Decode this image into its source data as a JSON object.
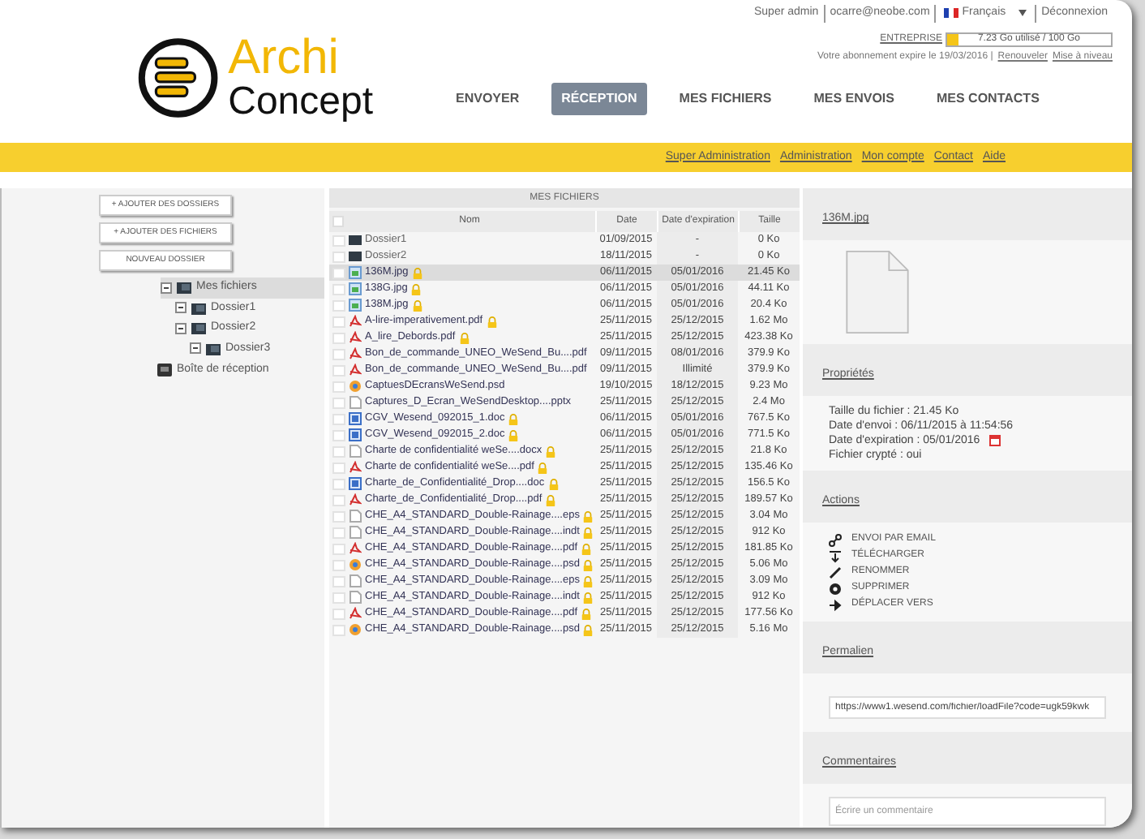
{
  "top_bar": {
    "user": "Super admin",
    "email": "ocarre@neobe.com",
    "language": "Français",
    "logout": "Déconnexion"
  },
  "logo": {
    "word_1": "Archi",
    "word_2": "Concept"
  },
  "quota": {
    "plan": "ENTREPRISE",
    "usage": "7.23 Go utilisé / 100 Go",
    "level": 0.07
  },
  "subscription": {
    "text": "Votre abonnement expire le 19/03/2016 |",
    "renew": "Renouveler",
    "upgrade": "Mise à niveau"
  },
  "nav_tabs": [
    {
      "label": "ENVOYER",
      "selected": false
    },
    {
      "label": "RÉCEPTION",
      "selected": true
    },
    {
      "label": "MES FICHIERS",
      "selected": false
    },
    {
      "label": "MES ENVOIS",
      "selected": false
    },
    {
      "label": "MES CONTACTS",
      "selected": false
    }
  ],
  "admin_links": [
    "Super Administration",
    "Administration",
    "Mon compte",
    "Contact",
    "Aide"
  ],
  "sidebar": {
    "buttons": [
      "+ AJOUTER DES DOSSIERS",
      "+ AJOUTER DES FICHIERS",
      "NOUVEAU DOSSIER"
    ],
    "tree": [
      {
        "label": "Mes fichiers",
        "selected": true,
        "expanded": true,
        "children": [
          {
            "label": "Dossier1",
            "selected": false,
            "expanded": true
          },
          {
            "label": "Dossier2",
            "selected": false,
            "expanded": true,
            "children": [
              {
                "label": "Dossier3",
                "selected": false,
                "expanded": true
              }
            ]
          }
        ]
      }
    ],
    "inbox": "Boîte de réception"
  },
  "table": {
    "title": "MES FICHIERS",
    "select_all_checked": false,
    "columns": [
      "Nom",
      "Date",
      "Date d'expiration",
      "Taille"
    ],
    "rows": [
      {
        "kind": "folder",
        "name": "Dossier1",
        "date": "01/09/2015",
        "expiry": "-",
        "size": "0 Ko",
        "locked": false,
        "selected": false,
        "checked": false
      },
      {
        "kind": "folder",
        "name": "Dossier2",
        "date": "18/11/2015",
        "expiry": "-",
        "size": "0 Ko",
        "locked": false,
        "selected": false,
        "checked": false
      },
      {
        "kind": "image",
        "name": "136M.jpg",
        "date": "06/11/2015",
        "expiry": "05/01/2016",
        "size": "21.45 Ko",
        "locked": true,
        "selected": true,
        "checked": false
      },
      {
        "kind": "image",
        "name": "138G.jpg",
        "date": "06/11/2015",
        "expiry": "05/01/2016",
        "size": "44.11 Ko",
        "locked": true,
        "selected": false,
        "checked": false
      },
      {
        "kind": "image",
        "name": "138M.jpg",
        "date": "06/11/2015",
        "expiry": "05/01/2016",
        "size": "20.4 Ko",
        "locked": true,
        "selected": false,
        "checked": false
      },
      {
        "kind": "pdf",
        "name": "A-lire-imperativement.pdf",
        "date": "25/11/2015",
        "expiry": "25/12/2015",
        "size": "1.62 Mo",
        "locked": true,
        "selected": false,
        "checked": false
      },
      {
        "kind": "pdf",
        "name": "A_lire_Debords.pdf",
        "date": "25/11/2015",
        "expiry": "25/12/2015",
        "size": "423.38 Ko",
        "locked": true,
        "selected": false,
        "checked": false
      },
      {
        "kind": "pdf",
        "name": "Bon_de_commande_UNEO_WeSend_Bu....pdf",
        "date": "09/11/2015",
        "expiry": "08/01/2016",
        "size": "379.9 Ko",
        "locked": false,
        "selected": false,
        "checked": false
      },
      {
        "kind": "pdf",
        "name": "Bon_de_commande_UNEO_WeSend_Bu....pdf",
        "date": "09/11/2015",
        "expiry": "Illimité",
        "size": "379.9 Ko",
        "locked": false,
        "selected": false,
        "checked": false
      },
      {
        "kind": "psd",
        "name": "CaptuesDEcransWeSend.psd",
        "date": "19/10/2015",
        "expiry": "18/12/2015",
        "size": "9.23 Mo",
        "locked": false,
        "selected": false,
        "checked": false
      },
      {
        "kind": "blank",
        "name": "Captures_D_Ecran_WeSendDesktop....pptx",
        "date": "25/11/2015",
        "expiry": "25/12/2015",
        "size": "2.4 Mo",
        "locked": false,
        "selected": false,
        "checked": false
      },
      {
        "kind": "doc",
        "name": "CGV_Wesend_092015_1.doc",
        "date": "06/11/2015",
        "expiry": "05/01/2016",
        "size": "767.5 Ko",
        "locked": true,
        "selected": false,
        "checked": false
      },
      {
        "kind": "doc",
        "name": "CGV_Wesend_092015_2.doc",
        "date": "06/11/2015",
        "expiry": "05/01/2016",
        "size": "771.5 Ko",
        "locked": true,
        "selected": false,
        "checked": false
      },
      {
        "kind": "blank",
        "name": "Charte de confidentialité weSe....docx",
        "date": "25/11/2015",
        "expiry": "25/12/2015",
        "size": "21.8 Ko",
        "locked": true,
        "selected": false,
        "checked": false
      },
      {
        "kind": "pdf",
        "name": "Charte de confidentialité weSe....pdf",
        "date": "25/11/2015",
        "expiry": "25/12/2015",
        "size": "135.46 Ko",
        "locked": true,
        "selected": false,
        "checked": false
      },
      {
        "kind": "doc",
        "name": "Charte_de_Confidentialité_Drop....doc",
        "date": "25/11/2015",
        "expiry": "25/12/2015",
        "size": "156.5 Ko",
        "locked": true,
        "selected": false,
        "checked": false
      },
      {
        "kind": "pdf",
        "name": "Charte_de_Confidentialité_Drop....pdf",
        "date": "25/11/2015",
        "expiry": "25/12/2015",
        "size": "189.57 Ko",
        "locked": true,
        "selected": false,
        "checked": false
      },
      {
        "kind": "blank",
        "name": "CHE_A4_STANDARD_Double-Rainage....eps",
        "date": "25/11/2015",
        "expiry": "25/12/2015",
        "size": "3.04 Mo",
        "locked": true,
        "selected": false,
        "checked": false
      },
      {
        "kind": "blank",
        "name": "CHE_A4_STANDARD_Double-Rainage....indt",
        "date": "25/11/2015",
        "expiry": "25/12/2015",
        "size": "912 Ko",
        "locked": true,
        "selected": false,
        "checked": false
      },
      {
        "kind": "pdf",
        "name": "CHE_A4_STANDARD_Double-Rainage....pdf",
        "date": "25/11/2015",
        "expiry": "25/12/2015",
        "size": "181.85 Ko",
        "locked": true,
        "selected": false,
        "checked": false
      },
      {
        "kind": "psd",
        "name": "CHE_A4_STANDARD_Double-Rainage....psd",
        "date": "25/11/2015",
        "expiry": "25/12/2015",
        "size": "5.06 Mo",
        "locked": true,
        "selected": false,
        "checked": false
      },
      {
        "kind": "blank",
        "name": "CHE_A4_STANDARD_Double-Rainage....eps",
        "date": "25/11/2015",
        "expiry": "25/12/2015",
        "size": "3.09 Mo",
        "locked": true,
        "selected": false,
        "checked": false
      },
      {
        "kind": "blank",
        "name": "CHE_A4_STANDARD_Double-Rainage....indt",
        "date": "25/11/2015",
        "expiry": "25/12/2015",
        "size": "912 Ko",
        "locked": true,
        "selected": false,
        "checked": false
      },
      {
        "kind": "pdf",
        "name": "CHE_A4_STANDARD_Double-Rainage....pdf",
        "date": "25/11/2015",
        "expiry": "25/12/2015",
        "size": "177.56 Ko",
        "locked": true,
        "selected": false,
        "checked": false
      },
      {
        "kind": "psd",
        "name": "CHE_A4_STANDARD_Double-Rainage....psd",
        "date": "25/11/2015",
        "expiry": "25/12/2015",
        "size": "5.16 Mo",
        "locked": true,
        "selected": false,
        "checked": false
      }
    ]
  },
  "details": {
    "file_name": "136M.jpg",
    "properties_title": "Propriétés",
    "properties": [
      {
        "kind": "text",
        "text": "Taille du fichier : 21.45 Ko"
      },
      {
        "kind": "text",
        "text": "Date d'envoi : 06/11/2015 à 11:54:56"
      },
      {
        "kind": "date",
        "text": "Date d'expiration : 05/01/2016"
      },
      {
        "kind": "text",
        "text": "Fichier crypté : oui"
      }
    ],
    "actions_title": "Actions",
    "actions": [
      {
        "kind": "email",
        "label": "ENVOI PAR EMAIL"
      },
      {
        "kind": "download",
        "label": "TÉLÉCHARGER"
      },
      {
        "kind": "rename",
        "label": "RENOMMER"
      },
      {
        "kind": "delete",
        "label": "SUPPRIMER"
      },
      {
        "kind": "move",
        "label": "DÉPLACER VERS"
      }
    ],
    "permalink_title": "Permalien",
    "permalink": "https://www1.wesend.com/fichier/loadFile?code=ugk59kwk",
    "comments_title": "Commentaires",
    "comment_placeholder": "Écrire un commentaire"
  }
}
